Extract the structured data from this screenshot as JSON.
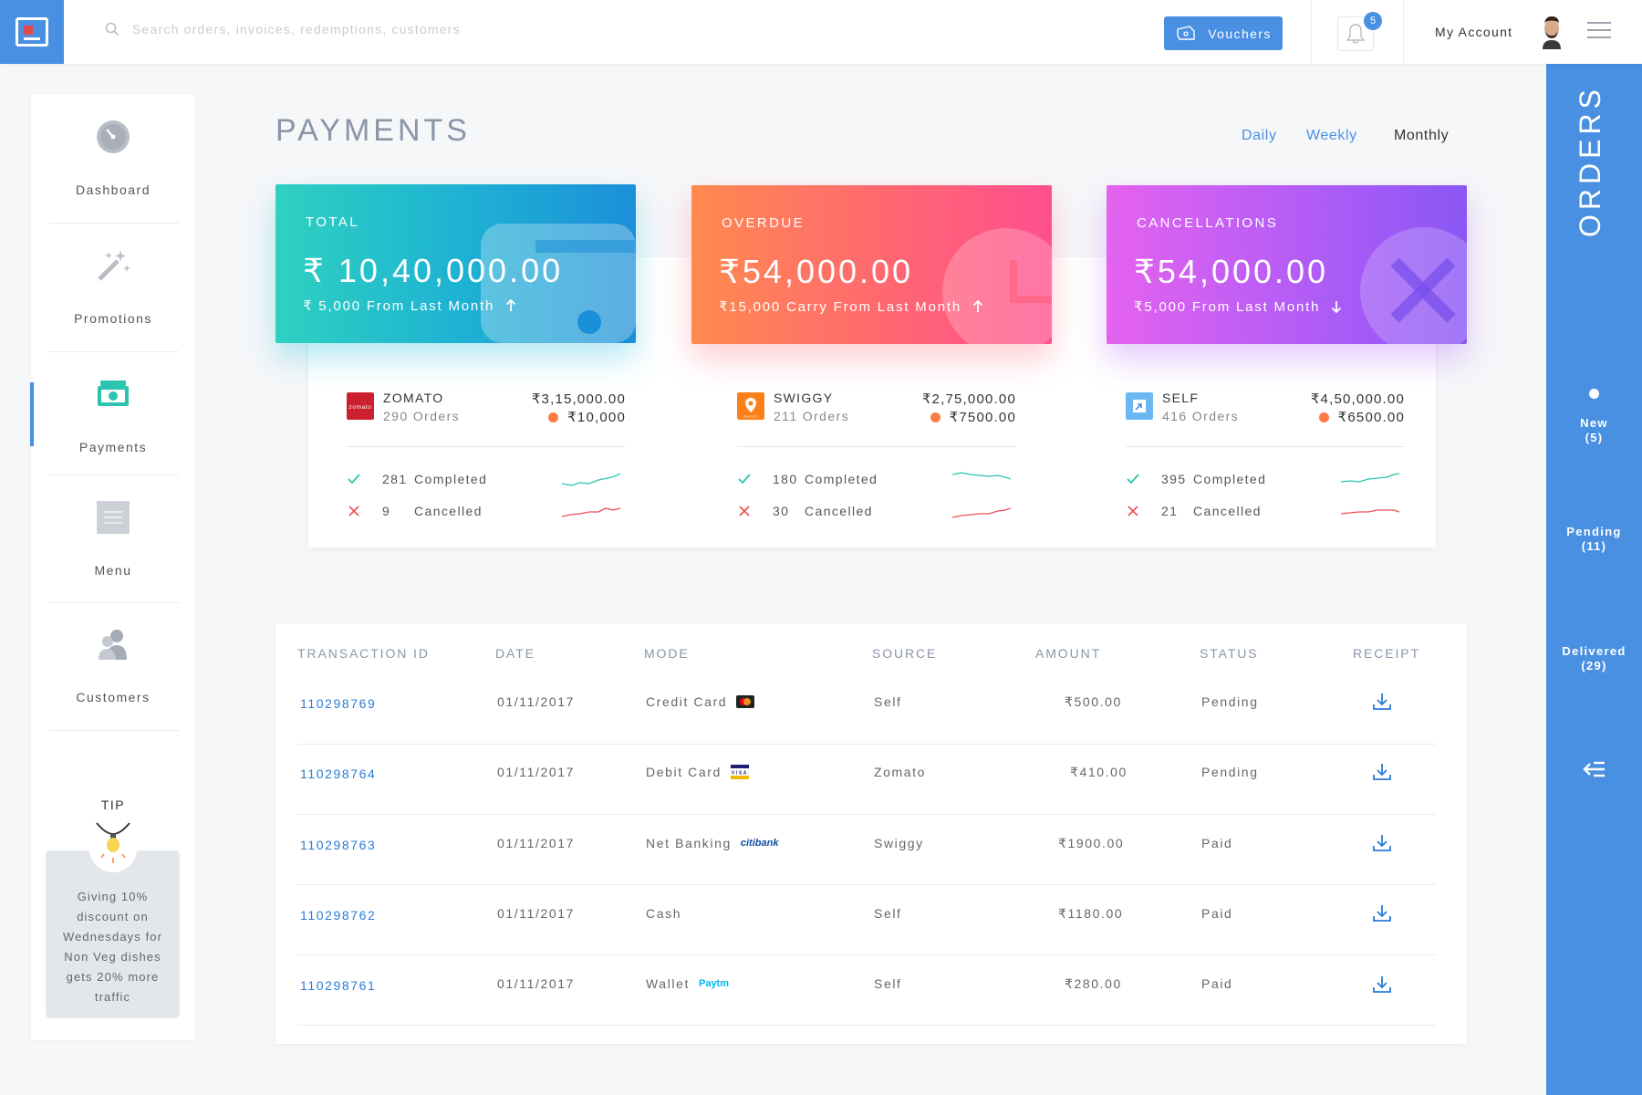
{
  "search": {
    "placeholder": "Search orders, invoices, redemptions, customers"
  },
  "header": {
    "vouchers_label": "Vouchers",
    "notification_count": "5",
    "account_label": "My Account"
  },
  "sidebar": {
    "items": [
      {
        "label": "Dashboard",
        "icon": "dashboard-gauge-icon"
      },
      {
        "label": "Promotions",
        "icon": "magic-wand-icon"
      },
      {
        "label": "Payments",
        "icon": "cash-icon"
      },
      {
        "label": "Menu",
        "icon": "menu-list-icon"
      },
      {
        "label": "Customers",
        "icon": "customers-icon"
      }
    ],
    "active": "Payments",
    "tip_title": "TIP",
    "tip_text": "Giving 10% discount on Wednesdays for Non Veg dishes gets 20% more traffic"
  },
  "page": {
    "title": "PAYMENTS",
    "periods": [
      "Daily",
      "Weekly",
      "Monthly"
    ],
    "selected_period": "Monthly"
  },
  "cards": [
    {
      "label": "TOTAL",
      "value": "₹ 10,40,000.00",
      "sub": "₹ 5,000 From Last Month",
      "trend": "up"
    },
    {
      "label": "OVERDUE",
      "value": "₹54,000.00",
      "sub": "₹15,000 Carry From Last Month",
      "trend": "up"
    },
    {
      "label": "CANCELLATIONS",
      "value": "₹54,000.00",
      "sub": "₹5,000 From Last Month",
      "trend": "down"
    }
  ],
  "sources": [
    {
      "name": "ZOMATO",
      "orders": "290  Orders",
      "amount": "₹3,15,000.00",
      "due": "₹10,000",
      "completed_count": "281",
      "completed_label": "Completed",
      "cancelled_count": "9",
      "cancelled_label": "Cancelled",
      "logo_text": "zomato"
    },
    {
      "name": "SWIGGY",
      "orders": "211 Orders",
      "amount": "₹2,75,000.00",
      "due": "₹7500.00",
      "completed_count": "180",
      "completed_label": "Completed",
      "cancelled_count": "30",
      "cancelled_label": "Cancelled",
      "logo_text": "SWIGGY"
    },
    {
      "name": "SELF",
      "orders": "416 Orders",
      "amount": "₹4,50,000.00",
      "due": "₹6500.00",
      "completed_count": "395",
      "completed_label": "Completed",
      "cancelled_count": "21",
      "cancelled_label": "Cancelled",
      "logo_text": ""
    }
  ],
  "table": {
    "headers": [
      "TRANSACTION ID",
      "DATE",
      "MODE",
      "SOURCE",
      "AMOUNT",
      "STATUS",
      "RECEIPT"
    ],
    "rows": [
      {
        "id": "110298769",
        "date": "01/11/2017",
        "mode": "Credit Card",
        "mode_icon": "mastercard-icon",
        "source": "Self",
        "amount": "₹500.00",
        "status": "Pending"
      },
      {
        "id": "110298764",
        "date": "01/11/2017",
        "mode": "Debit Card",
        "mode_icon": "visa-icon",
        "source": "Zomato",
        "amount": "₹410.00",
        "status": "Pending"
      },
      {
        "id": "110298763",
        "date": "01/11/2017",
        "mode": "Net Banking",
        "mode_icon": "citibank-icon",
        "mode_logo_text": "citibank",
        "source": "Swiggy",
        "amount": "₹1900.00",
        "status": "Paid"
      },
      {
        "id": "110298762",
        "date": "01/11/2017",
        "mode": "Cash",
        "mode_icon": "",
        "source": "Self",
        "amount": "₹1180.00",
        "status": "Paid"
      },
      {
        "id": "110298761",
        "date": "01/11/2017",
        "mode": "Wallet",
        "mode_icon": "paytm-icon",
        "mode_logo_text": "Paytm",
        "source": "Self",
        "amount": "₹280.00",
        "status": "Paid"
      }
    ]
  },
  "orders_panel": {
    "title": "ORDERS",
    "items": [
      {
        "label": "New",
        "count": "(5)"
      },
      {
        "label": "Pending",
        "count": "(11)"
      },
      {
        "label": "Delivered",
        "count": "(29)"
      }
    ]
  },
  "colors": {
    "brand": "#4a90e2",
    "link": "#2a7bd6",
    "completed": "#2bc4b0",
    "cancelled": "#ef4f4f",
    "overdue_dot": "#ff7b45"
  }
}
